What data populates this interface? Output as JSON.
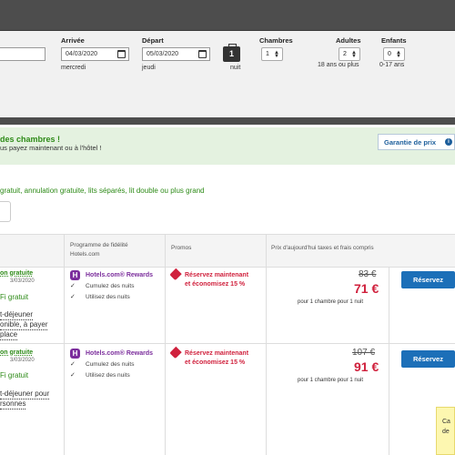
{
  "search": {
    "destination_value": "",
    "arrival_label": "Arrivée",
    "arrival_value": "04/03/2020",
    "arrival_day": "mercredi",
    "departure_label": "Départ",
    "departure_value": "05/03/2020",
    "departure_day": "jeudi",
    "nights_value": "1",
    "nights_label": "nuit",
    "rooms_label": "Chambres",
    "rooms_value": "1",
    "adults_label": "Adultes",
    "adults_value": "2",
    "adults_hint": "18 ans ou plus",
    "children_label": "Enfants",
    "children_value": "0",
    "children_hint": "0-17 ans"
  },
  "banner": {
    "title": "des chambres !",
    "subtitle": "us payez maintenant ou à l'hôtel !",
    "guarantee": "Garantie de prix"
  },
  "filters_text": "gratuit, annulation gratuite, lits séparés, lit double ou plus grand",
  "table": {
    "headers": {
      "loyalty": "Programme de fidélité Hotels.com",
      "promos": "Promos",
      "price": "Prix d'aujourd'hui taxes et frais compris"
    },
    "rows": [
      {
        "cancel": "on gratuite",
        "cancel_date": "3/03/2020",
        "wifi": "Fi gratuit",
        "breakfast": [
          "t-déjeuner",
          "onible, à payer",
          "place"
        ],
        "rewards_title": "Hotels.com® Rewards",
        "benefits": [
          "Cumulez des nuits",
          "Utilisez des nuits"
        ],
        "promo": [
          "Réservez maintenant",
          "et économisez 15 %"
        ],
        "old_price": "83 €",
        "new_price": "71 €",
        "per": "pour 1 chambre pour 1 nuit",
        "book": "Réservez"
      },
      {
        "cancel": "on gratuite",
        "cancel_date": "3/03/2020",
        "wifi": "Fi gratuit",
        "breakfast": [
          "t-déjeuner pour",
          "rsonnes"
        ],
        "rewards_title": "Hotels.com® Rewards",
        "benefits": [
          "Cumulez des nuits",
          "Utilisez des nuits"
        ],
        "promo": [
          "Réservez maintenant",
          "et économisez 15 %"
        ],
        "old_price": "107 €",
        "new_price": "91 €",
        "per": "pour 1 chambre pour 1 nuit",
        "book": "Réservez"
      }
    ]
  },
  "sticky_note": [
    "Ca",
    "de"
  ],
  "icons": {
    "calendar": "calendar-icon",
    "nights": "briefcase-icon",
    "rewards": "hotels-rewards-icon",
    "check": "check-icon",
    "promo": "tag-icon",
    "guarantee": "info-icon"
  },
  "colors": {
    "green": "#2e8b18",
    "red": "#d0213d",
    "blue": "#1c6fb8",
    "purple": "#7b2d9c"
  }
}
